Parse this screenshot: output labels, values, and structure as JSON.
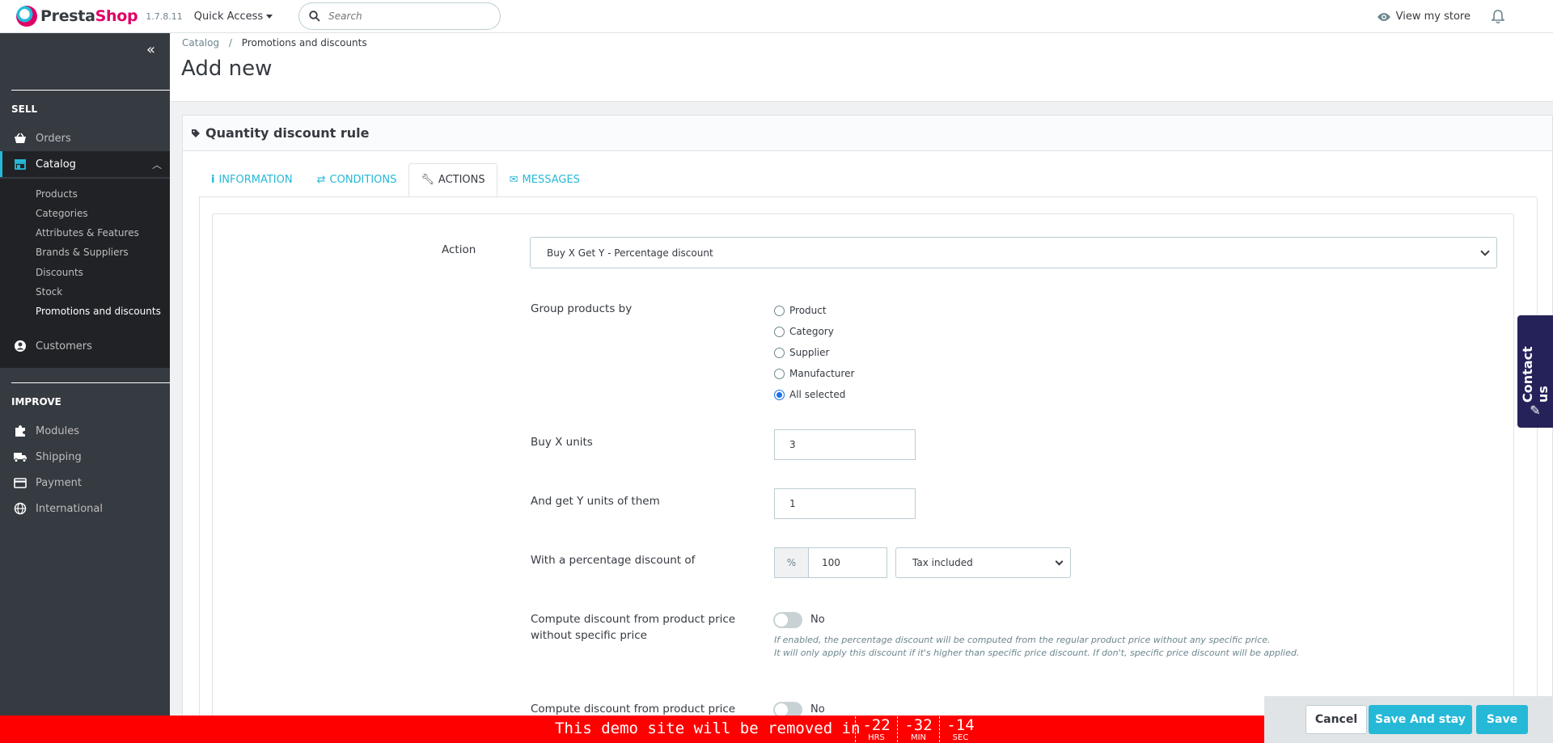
{
  "header": {
    "logo_text_a": "Presta",
    "logo_text_b": "Shop",
    "version": "1.7.8.11",
    "quick_access": "Quick Access",
    "search_placeholder": "Search",
    "view_store": "View my store"
  },
  "sidebar": {
    "section_sell": "SELL",
    "section_improve": "IMPROVE",
    "orders": "Orders",
    "catalog": "Catalog",
    "catalog_sub": [
      "Products",
      "Categories",
      "Attributes & Features",
      "Brands & Suppliers",
      "Discounts",
      "Stock",
      "Promotions and discounts"
    ],
    "customers": "Customers",
    "modules": "Modules",
    "shipping": "Shipping",
    "payment": "Payment",
    "international": "International"
  },
  "breadcrumb": {
    "parent": "Catalog",
    "sep": "/",
    "current": "Promotions and discounts"
  },
  "page_title": "Add new",
  "panel": {
    "title": "Quantity discount rule",
    "tabs": [
      "INFORMATION",
      "CONDITIONS",
      "ACTIONS",
      "MESSAGES"
    ],
    "action_label": "Action",
    "action_value": "Buy X Get Y - Percentage discount",
    "group_label": "Group products by",
    "group_options": [
      "Product",
      "Category",
      "Supplier",
      "Manufacturer",
      "All selected"
    ],
    "group_selected": "All selected",
    "buy_label": "Buy X units",
    "buy_value": "3",
    "get_label": "And get Y units of them",
    "get_value": "1",
    "percent_label": "With a percentage discount of",
    "percent_addon": "%",
    "percent_value": "100",
    "tax_value": "Tax included",
    "compute1_label_1": "Compute discount from product price",
    "compute1_label_2": "without specific price",
    "compute1_value": "No",
    "compute1_help_1": "If enabled, the percentage discount will be computed from the regular product price without any specific price.",
    "compute1_help_2": "It will only apply this discount if it's higher than specific price discount. If don't, specific price discount will be applied.",
    "compute2_label": "Compute discount from product price",
    "compute2_value": "No"
  },
  "contact_us": "Contact us",
  "footer": {
    "cancel": "Cancel",
    "save_stay": "Save And stay",
    "save": "Save"
  },
  "demo_banner": {
    "text": "This demo site will be removed in",
    "hrs": "-22",
    "hrs_unit": "HRS",
    "min": "-32",
    "min_unit": "MIN",
    "sec": "-14",
    "sec_unit": "SEC"
  },
  "colors": {
    "accent": "#25b9d7",
    "brand_pink": "#df0067",
    "sidebar": "#363a41",
    "banner": "#ff0000",
    "contact": "#25225a"
  }
}
